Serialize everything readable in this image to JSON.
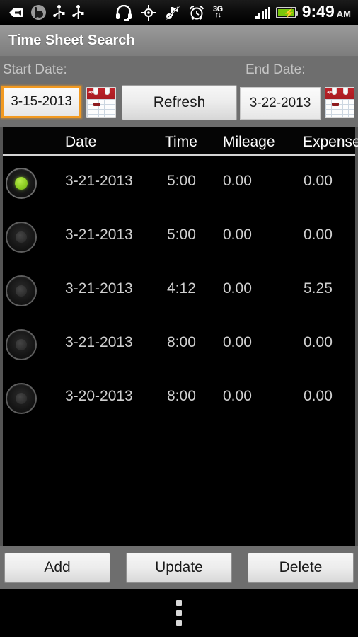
{
  "status_bar": {
    "icons": [
      {
        "name": "back-tag-icon",
        "glyph": "◀"
      },
      {
        "name": "beats-audio-icon",
        "glyph": "b"
      },
      {
        "name": "usb-icon",
        "glyph": "⑂"
      },
      {
        "name": "usb-icon-2",
        "glyph": "⑂"
      },
      {
        "name": "headset-icon",
        "glyph": "Ω"
      },
      {
        "name": "gps-icon",
        "glyph": "⊕"
      },
      {
        "name": "sound-off-icon",
        "glyph": "♪"
      },
      {
        "name": "alarm-icon",
        "glyph": "⏰"
      }
    ],
    "network_label": "3G",
    "network_arrows": "↑↓",
    "time": "9:49",
    "ampm": "AM",
    "battery_charging": true
  },
  "title_bar": {
    "title": "Time Sheet Search"
  },
  "search_panel": {
    "start_label": "Start Date:",
    "end_label": "End Date:",
    "start_date": "3-15-2013",
    "end_date": "3-22-2013",
    "start_focused": true,
    "refresh_label": "Refresh",
    "calendar_mini_text": "April",
    "focus_color": "#f29a21"
  },
  "table": {
    "columns": [
      "Date",
      "Time",
      "Mileage",
      "Expense"
    ],
    "rows": [
      {
        "selected": true,
        "date": "3-21-2013",
        "time": "5:00",
        "mileage": "0.00",
        "expense": "0.00"
      },
      {
        "selected": false,
        "date": "3-21-2013",
        "time": "5:00",
        "mileage": "0.00",
        "expense": "0.00"
      },
      {
        "selected": false,
        "date": "3-21-2013",
        "time": "4:12",
        "mileage": "0.00",
        "expense": "5.25"
      },
      {
        "selected": false,
        "date": "3-21-2013",
        "time": "8:00",
        "mileage": "0.00",
        "expense": "0.00"
      },
      {
        "selected": false,
        "date": "3-20-2013",
        "time": "8:00",
        "mileage": "0.00",
        "expense": "0.00"
      }
    ],
    "selected_color": "#8ece24"
  },
  "action_bar": {
    "add_label": "Add",
    "update_label": "Update",
    "delete_label": "Delete"
  },
  "nav_bar": {
    "overflow_name": "overflow-menu-icon"
  }
}
